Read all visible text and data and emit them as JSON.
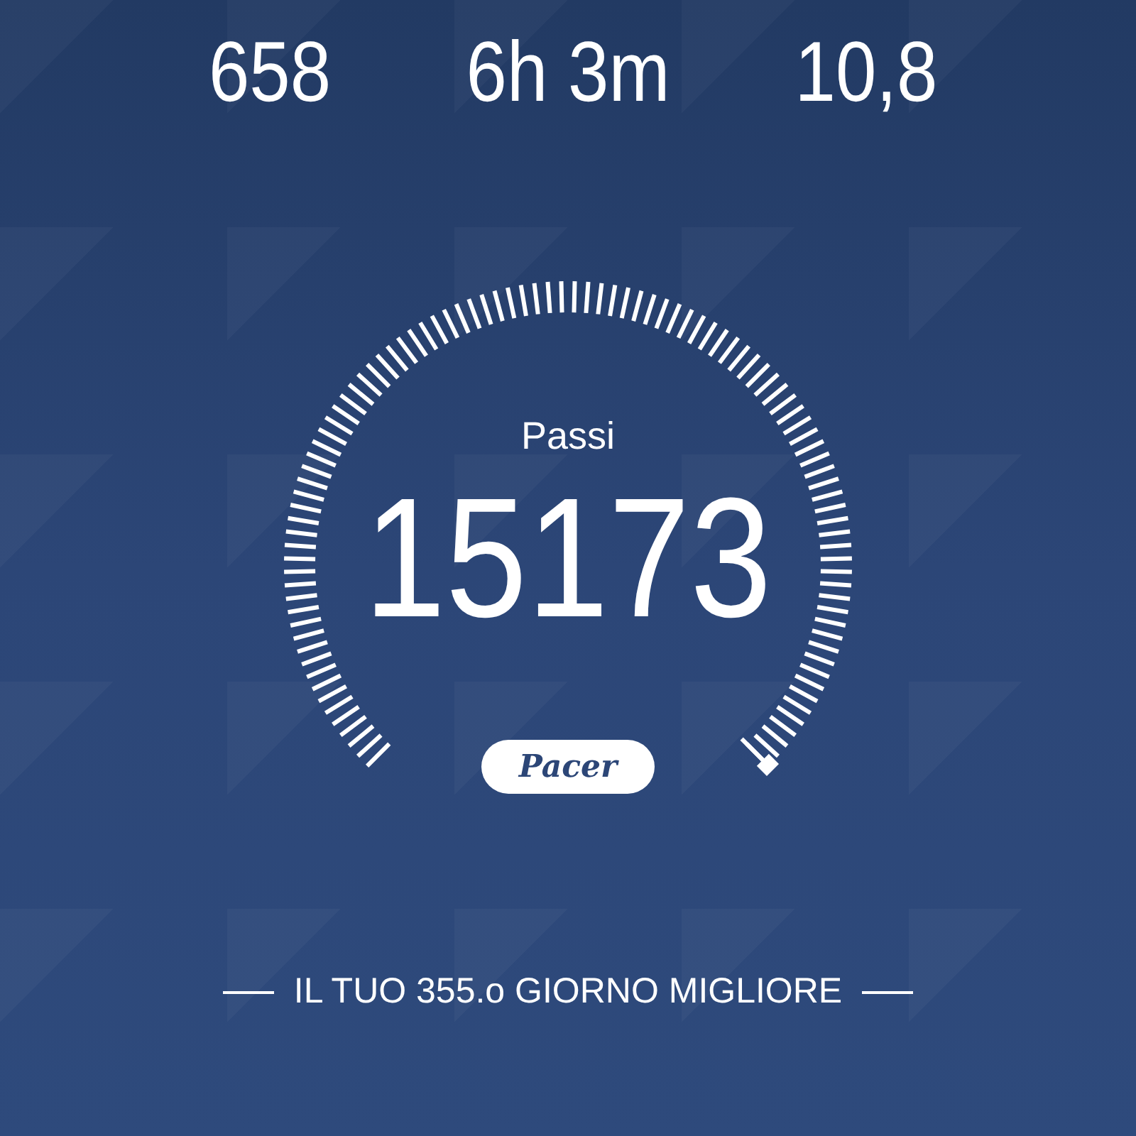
{
  "stats": [
    {
      "value": "658"
    },
    {
      "value": "6h 3m"
    },
    {
      "value": "10,8"
    }
  ],
  "gauge": {
    "label": "Passi",
    "value": "15173"
  },
  "brand": "Pacer",
  "footer": "IL TUO 355.o GIORNO MIGLIORE"
}
